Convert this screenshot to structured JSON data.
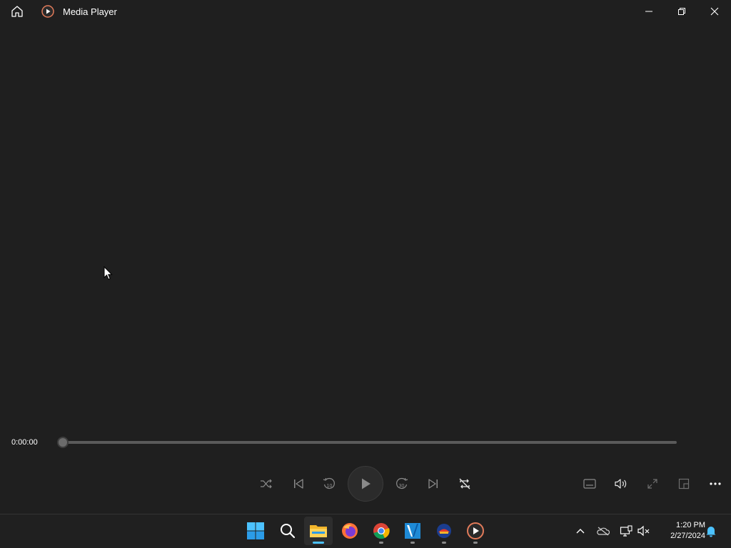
{
  "window": {
    "title": "Media Player",
    "app_icon": "media-player-icon",
    "home_icon": "home-icon",
    "controls": [
      "minimize-icon",
      "restore-icon",
      "close-icon"
    ]
  },
  "playback": {
    "elapsed": "0:00:00",
    "progress_fraction": 0.0
  },
  "transport": [
    "shuffle-icon",
    "previous-icon",
    "rewind-10-icon",
    "play-icon",
    "forward-30-icon",
    "next-icon",
    "repeat-icon"
  ],
  "transport_labels": {
    "rewind": "10",
    "forward": "30"
  },
  "secondary": [
    "captions-icon",
    "volume-icon",
    "fullscreen-icon",
    "mini-view-icon",
    "more-icon"
  ],
  "taskbar": {
    "apps": [
      "windows-start-icon",
      "search-icon",
      "file-explorer-icon",
      "firefox-icon",
      "chrome-icon",
      "vs-code-icon",
      "app-icon",
      "media-player-icon"
    ],
    "tray": [
      "chevron-up-icon",
      "onedrive-icon",
      "network-icon",
      "volume-muted-icon",
      "notification-bell-icon"
    ],
    "time": "1:20 PM",
    "date": "2/27/2024"
  },
  "colors": {
    "background": "#1f1f1f",
    "taskbar": "#202020",
    "accent": "#4cc2ff"
  }
}
